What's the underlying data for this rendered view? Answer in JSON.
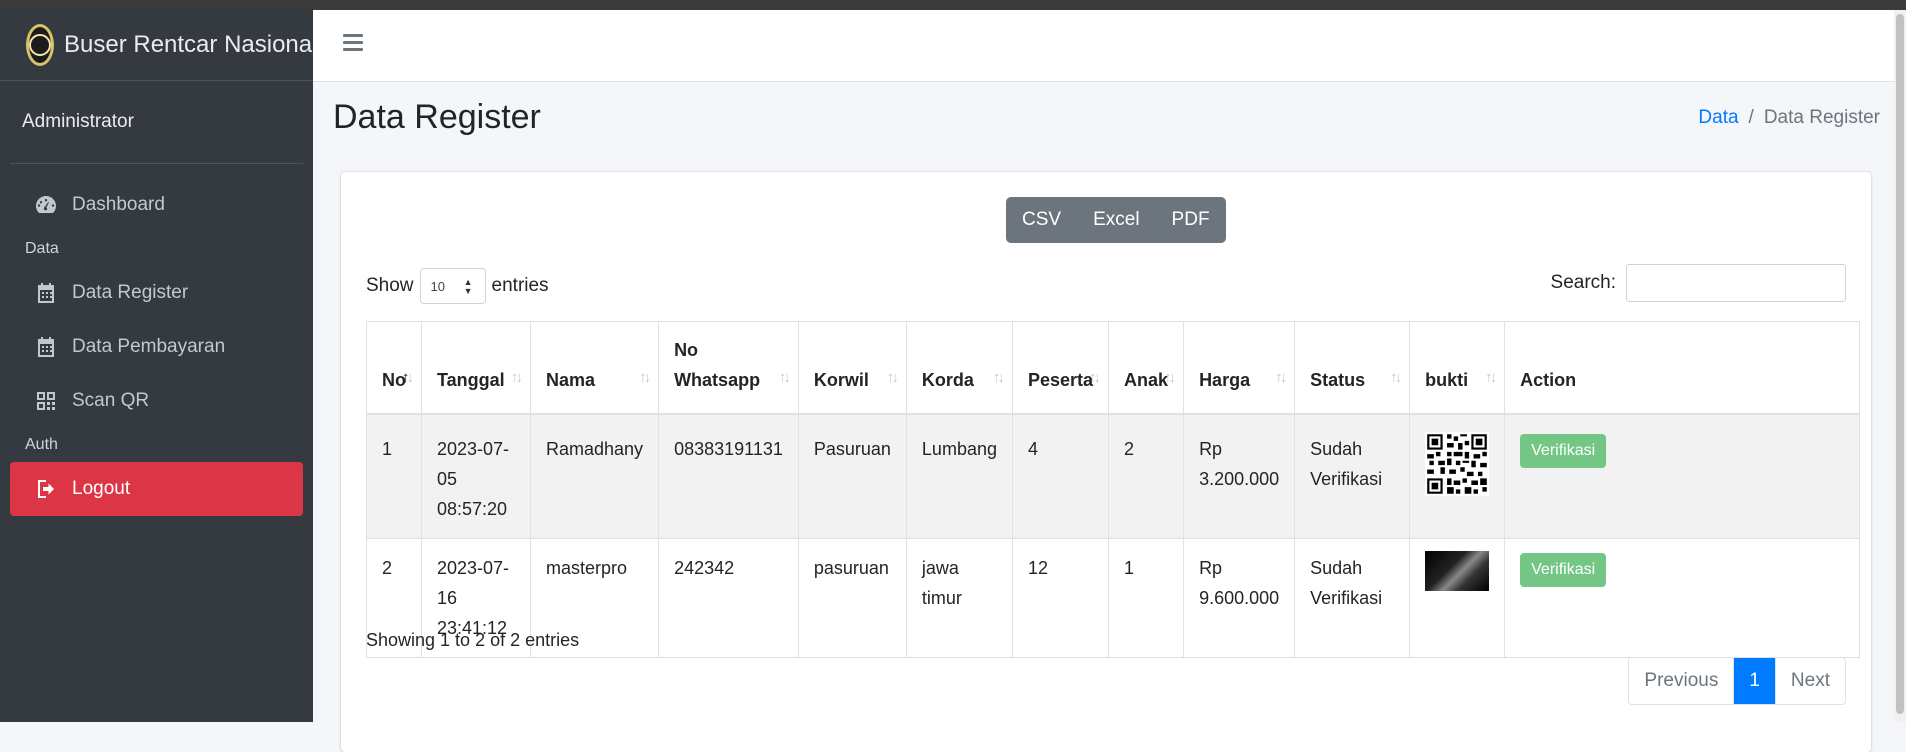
{
  "brand": {
    "name": "Buser Rentcar Nasional"
  },
  "user": {
    "name": "Administrator"
  },
  "sidebar": {
    "items": [
      {
        "label": "Dashboard",
        "icon": "tachometer-icon"
      },
      {
        "header": "Data"
      },
      {
        "label": "Data Register",
        "icon": "calendar-icon"
      },
      {
        "label": "Data Pembayaran",
        "icon": "calendar-icon"
      },
      {
        "label": "Scan QR",
        "icon": "qrcode-icon"
      },
      {
        "header": "Auth"
      },
      {
        "label": "Logout",
        "icon": "sign-out-icon"
      }
    ]
  },
  "page": {
    "title": "Data Register"
  },
  "breadcrumb": {
    "parent": "Data",
    "separator": "/",
    "current": "Data Register"
  },
  "export": {
    "csv": "CSV",
    "excel": "Excel",
    "pdf": "PDF"
  },
  "length": {
    "show": "Show",
    "value": "10",
    "entries": "entries"
  },
  "search": {
    "label": "Search:",
    "value": ""
  },
  "table": {
    "headers": [
      "No",
      "Tanggal",
      "Nama",
      "No Whatsapp",
      "Korwil",
      "Korda",
      "Peserta",
      "Anak",
      "Harga",
      "Status",
      "bukti",
      "Action"
    ],
    "header_whatsapp_line1": "No",
    "header_whatsapp_line2": "Whatsapp",
    "rows": [
      {
        "no": "1",
        "tanggal_date": "2023-07-05",
        "tanggal_time": "08:57:20",
        "nama": "Ramadhany",
        "whatsapp": "08383191131",
        "korwil": "Pasuruan",
        "korda": "Lumbang",
        "korda2": "",
        "peserta": "4",
        "anak": "2",
        "harga_cur": "Rp",
        "harga_val": "3.200.000",
        "status1": "Sudah",
        "status2": "Verifikasi",
        "action": "Verifikasi"
      },
      {
        "no": "2",
        "tanggal_date": "2023-07-16",
        "tanggal_time": "23:41:12",
        "nama": "masterpro",
        "whatsapp": "242342",
        "korwil": "pasuruan",
        "korda": "jawa",
        "korda2": "timur",
        "peserta": "12",
        "anak": "1",
        "harga_cur": "Rp",
        "harga_val": "9.600.000",
        "status1": "Sudah",
        "status2": "Verifikasi",
        "action": "Verifikasi"
      }
    ]
  },
  "info": "Showing 1 to 2 of 2 entries",
  "pagination": {
    "previous": "Previous",
    "current": "1",
    "next": "Next"
  },
  "colors": {
    "sidebar": "#343a40",
    "logout": "#dc3545",
    "accent": "#007bff",
    "verify": "#74c685",
    "export": "#6c757d"
  }
}
